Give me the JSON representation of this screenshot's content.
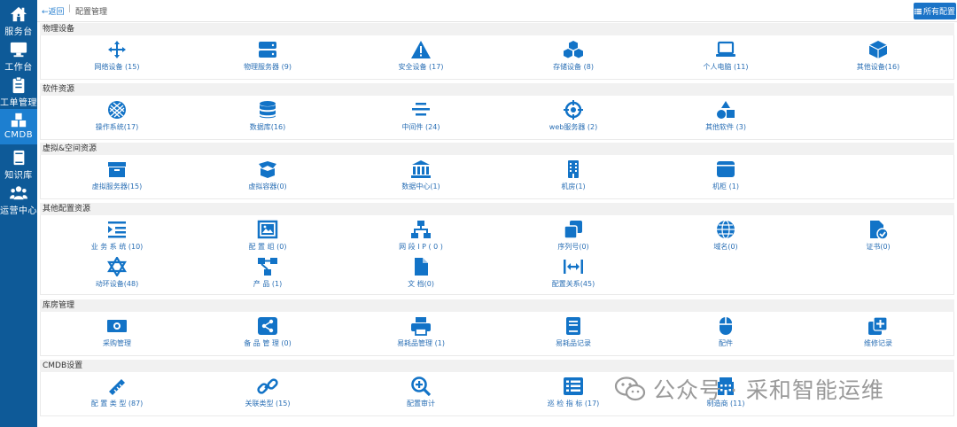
{
  "colors": {
    "sidebar": "#0e5a98",
    "sidebar_active": "#1d7fd0",
    "icon": "#1273c7",
    "label": "#2a6fb5"
  },
  "sidebar": {
    "items": [
      {
        "label": "服务台",
        "icon": "home-icon"
      },
      {
        "label": "工作台",
        "icon": "monitor-icon"
      },
      {
        "label": "工单管理",
        "icon": "clipboard-icon"
      },
      {
        "label": "CMDB",
        "icon": "cubes-icon",
        "active": true
      },
      {
        "label": "知识库",
        "icon": "book-icon"
      },
      {
        "label": "运营中心",
        "icon": "users-icon"
      }
    ]
  },
  "topbar": {
    "back_label": "返回",
    "separator": "|",
    "breadcrumb": "配置管理",
    "all_config_label": "所有配置"
  },
  "sections": [
    {
      "title": "物理设备",
      "items": [
        {
          "label": "网络设备 (15)",
          "icon": "arrows-move-icon"
        },
        {
          "label": "物理服务器 (9)",
          "icon": "server-icon"
        },
        {
          "label": "安全设备 (17)",
          "icon": "warning-icon"
        },
        {
          "label": "存储设备 (8)",
          "icon": "cubes-icon"
        },
        {
          "label": "个人电脑 (11)",
          "icon": "laptop-icon"
        },
        {
          "label": "其他设备(16)",
          "icon": "cube-icon"
        }
      ]
    },
    {
      "title": "软件资源",
      "items": [
        {
          "label": "操作系统(17)",
          "icon": "os-icon"
        },
        {
          "label": "数据库(16)",
          "icon": "database-icon"
        },
        {
          "label": "中间件 (24)",
          "icon": "align-center-icon"
        },
        {
          "label": "web服务器 (2)",
          "icon": "crosshair-icon"
        },
        {
          "label": "其他软件 (3)",
          "icon": "shapes-icon"
        }
      ]
    },
    {
      "title": "虚拟&空间资源",
      "items": [
        {
          "label": "虚拟服务器(15)",
          "icon": "box-icon"
        },
        {
          "label": "虚拟容器(0)",
          "icon": "box-open-icon"
        },
        {
          "label": "数据中心(1)",
          "icon": "building-columns-icon"
        },
        {
          "label": "机房(1)",
          "icon": "building-icon"
        },
        {
          "label": "机柜 (1)",
          "icon": "window-icon"
        }
      ]
    },
    {
      "title": "其他配置资源",
      "items": [
        {
          "label": "业 务 系 统 (10)",
          "icon": "indent-icon"
        },
        {
          "label": "配 置 组 (0)",
          "icon": "group-frame-icon"
        },
        {
          "label": "网 段 I P ( 0 )",
          "icon": "network-icon"
        },
        {
          "label": "序列号(0)",
          "icon": "clone-icon"
        },
        {
          "label": "域名(0)",
          "icon": "globe-icon"
        },
        {
          "label": "证书(0)",
          "icon": "file-check-icon"
        },
        {
          "label": "动环设备(48)",
          "icon": "star-of-david-icon"
        },
        {
          "label": "产 品 (1)",
          "icon": "sitemap-icon"
        },
        {
          "label": "文 档(0)",
          "icon": "file-icon"
        },
        {
          "label": "配置关系(45)",
          "icon": "arrows-left-right-icon"
        }
      ]
    },
    {
      "title": "库房管理",
      "items": [
        {
          "label": "采购管理",
          "icon": "money-bill-icon"
        },
        {
          "label": "备 品 管 理 (0)",
          "icon": "share-icon"
        },
        {
          "label": "易耗品管理 (1)",
          "icon": "printer-icon"
        },
        {
          "label": "易耗品记录",
          "icon": "book-icon"
        },
        {
          "label": "配件",
          "icon": "mouse-icon"
        },
        {
          "label": "维修记录",
          "icon": "square-plus-icon"
        }
      ]
    },
    {
      "title": "CMDB设置",
      "items": [
        {
          "label": "配 置 类 型 (87)",
          "icon": "ruler-icon"
        },
        {
          "label": "关联类型 (15)",
          "icon": "link-icon"
        },
        {
          "label": "配置审计",
          "icon": "search-plus-icon"
        },
        {
          "label": "巡 检 指 标 (17)",
          "icon": "list-icon"
        },
        {
          "label": "制造商 (11)",
          "icon": "factory-icon"
        }
      ]
    }
  ],
  "watermark": {
    "text": "公众号 · 采和智能运维",
    "icon": "wechat-icon"
  }
}
